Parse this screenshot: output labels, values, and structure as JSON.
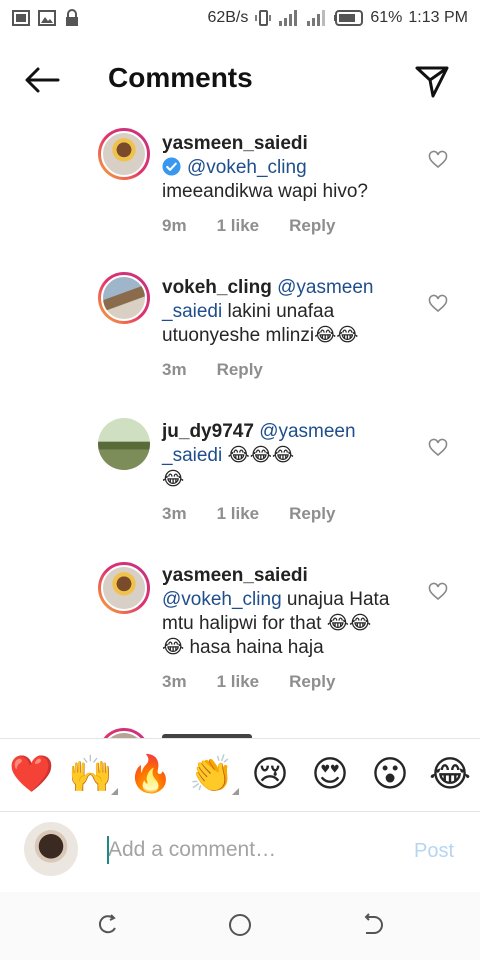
{
  "status_bar": {
    "net_speed": "62B/s",
    "battery": "61%",
    "time": "1:13 PM"
  },
  "header": {
    "title": "Comments"
  },
  "comments": [
    {
      "username": "yasmeen_saiedi",
      "verified": true,
      "mention": "@vokeh_cling",
      "text": "imeeandikwa wapi hivo?",
      "time": "9m",
      "likes": "1 like",
      "reply": "Reply"
    },
    {
      "username": "vokeh_cling",
      "mention_line1": "@yasmeen",
      "mention_line2": "_saiedi",
      "text_line2": "lakini unafaa",
      "text_line3": "utuonyeshe mlinzi😂😂",
      "time": "3m",
      "reply": "Reply"
    },
    {
      "username": "ju_dy9747",
      "mention_line1": "@yasmeen",
      "mention_line2": "_saiedi",
      "emojis_line2": "😂😂😂",
      "emojis_line3": "😂",
      "time": "3m",
      "likes": "1 like",
      "reply": "Reply"
    },
    {
      "username": "yasmeen_saiedi",
      "mention": "@vokeh_cling",
      "text_line2": "unajua Hata",
      "text_line3": "mtu halipwi for that 😂😂",
      "text_line4": "😂 hasa haina haja",
      "time": "3m",
      "likes": "1 like",
      "reply": "Reply"
    }
  ],
  "emoji_bar": [
    "❤️",
    "🙌",
    "🔥",
    "👏",
    "😢",
    "😍",
    "😮",
    "😂"
  ],
  "compose": {
    "placeholder": "Add a comment…",
    "post_label": "Post"
  },
  "colors": {
    "mention": "#1f4e8c",
    "meta": "#8e8e8e",
    "post_disabled": "#b4d6f3",
    "story_ring": "#e1306c"
  }
}
